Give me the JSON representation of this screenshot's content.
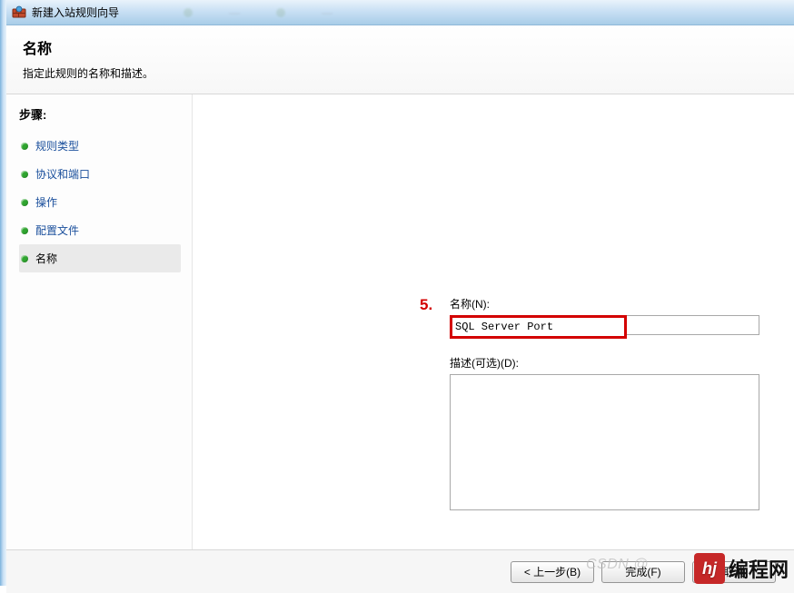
{
  "window": {
    "title": "新建入站规则向导"
  },
  "header": {
    "title": "名称",
    "subtitle": "指定此规则的名称和描述。"
  },
  "sidebar": {
    "steps_label": "步骤:",
    "items": [
      {
        "label": "规则类型",
        "link": true
      },
      {
        "label": "协议和端口",
        "link": true
      },
      {
        "label": "操作",
        "link": true
      },
      {
        "label": "配置文件",
        "link": true
      },
      {
        "label": "名称",
        "link": false,
        "active": true
      }
    ]
  },
  "annotation": {
    "number": "5."
  },
  "form": {
    "name_label": "名称(N):",
    "name_value": "SQL Server Port",
    "desc_label": "描述(可选)(D):",
    "desc_value": ""
  },
  "footer": {
    "back": "< 上一步(B)",
    "finish": "完成(F)",
    "cancel": "取消"
  },
  "watermark": {
    "csdn": "CSDN @",
    "badge": "hj",
    "text": "编程网"
  }
}
